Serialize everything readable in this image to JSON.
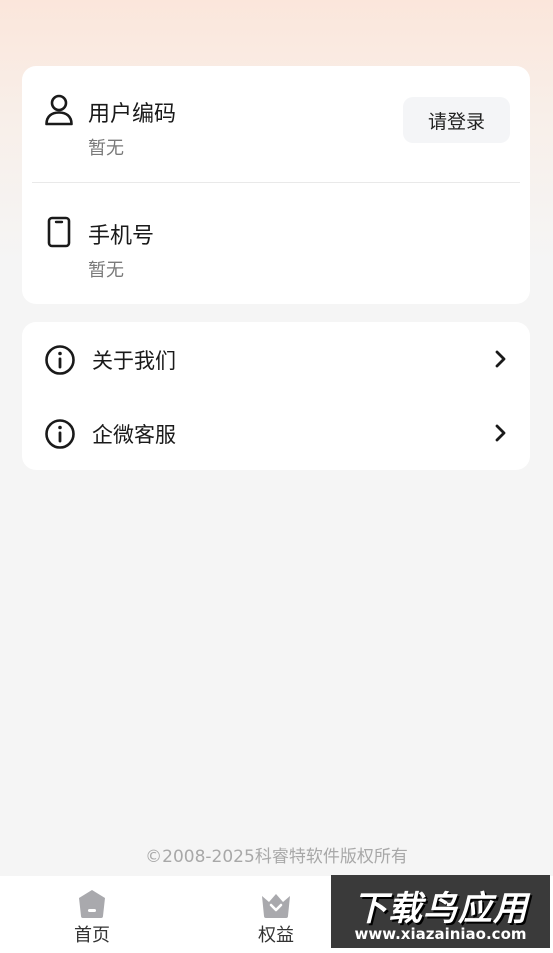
{
  "colors": {
    "background": "#f5f5f5",
    "card": "#ffffff",
    "text_primary": "#1a1a1a",
    "text_secondary": "#7a7a7a",
    "tab_icon": "#a9a9ad",
    "watermark_bg": "#3a3a3a"
  },
  "account": {
    "user_code": {
      "title": "用户编码",
      "value": "暂无",
      "icon": "user-icon"
    },
    "login_button": "请登录",
    "phone": {
      "title": "手机号",
      "value": "暂无",
      "icon": "phone-icon"
    }
  },
  "menu": {
    "items": [
      {
        "label": "关于我们",
        "icon": "info-icon"
      },
      {
        "label": "企微客服",
        "icon": "info-icon"
      }
    ]
  },
  "footer": {
    "copyright": "©2008-2025科睿特软件版权所有"
  },
  "tabbar": {
    "tabs": [
      {
        "label": "首页",
        "icon": "home-icon"
      },
      {
        "label": "权益",
        "icon": "crown-basket-icon"
      }
    ]
  },
  "watermark": {
    "title": "下载鸟应用",
    "url": "www.xiazainiao.com"
  }
}
